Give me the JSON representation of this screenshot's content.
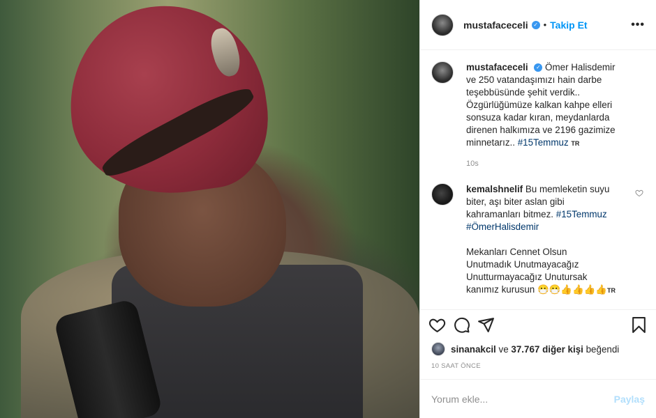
{
  "photo": {
    "alt": ""
  },
  "header": {
    "username": "mustafaceceli",
    "follow_label": "Takip Et",
    "more_label": "•••"
  },
  "caption": {
    "username": "mustafaceceli",
    "text": "Ömer Halisdemir ve 250 vatandaşımızı hain darbe teşebbüsünde şehit verdik.. Özgürlüğümüze kalkan kahpe elleri sonsuza kadar kıran, meydanlarda direnen halkımıza ve 2196 gazimize minnetarız..",
    "hashtag": "#15Temmuz",
    "lang": "TR",
    "time": "10s"
  },
  "comment": {
    "username": "kemalshnelif",
    "text": "Bu memleketin suyu biter, aşı biter aslan gibi kahramanları bitmez.",
    "hashtags": "#15Temmuz #ÖmerHalisdemir",
    "text2": "Mekanları Cennet Olsun\nUnutmadık Unutmayacağız\nUnutturmayacağız Unutursak kanımız kurusun",
    "emojis": "😷😷👍👍👍👍",
    "lang": "TR"
  },
  "likes": {
    "user": "sinanakcil",
    "connector": "ve",
    "count_text": "37.767 diğer kişi",
    "suffix": "beğendi"
  },
  "timestamp": "10 SAAT ÖNCE",
  "add_comment": {
    "placeholder": "Yorum ekle...",
    "post_label": "Paylaş"
  },
  "colors": {
    "link_blue": "#0095f6",
    "hashtag": "#00376b",
    "muted": "#8e8e8e",
    "post_disabled": "#b2dffc"
  }
}
